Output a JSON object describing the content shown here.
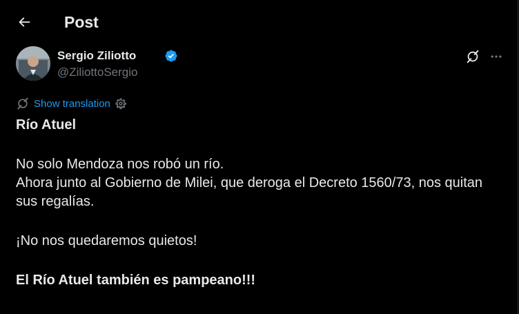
{
  "header": {
    "title": "Post",
    "back_icon": "arrow-left-icon"
  },
  "author": {
    "name": "Sergio Ziliotto",
    "handle": "@ZiliottoSergio",
    "verified": true,
    "verified_color": "#1d9bf0"
  },
  "actions": {
    "grok_icon": "grok-icon",
    "more_icon": "more-horizontal-icon"
  },
  "translation": {
    "label": "Show translation",
    "link_color": "#1d9bf0"
  },
  "post": {
    "title": "Río Atuel",
    "line1": "No solo Mendoza nos robó un río.",
    "line2": "Ahora junto al Gobierno de Milei, que deroga el Decreto 1560/73, nos quitan sus regalías.",
    "line3": "¡No nos quedaremos quietos!",
    "line4": "El Río Atuel también es pampeano!!!"
  },
  "colors": {
    "background": "#000000",
    "text_primary": "#e7e9ea",
    "text_secondary": "#71767b"
  }
}
